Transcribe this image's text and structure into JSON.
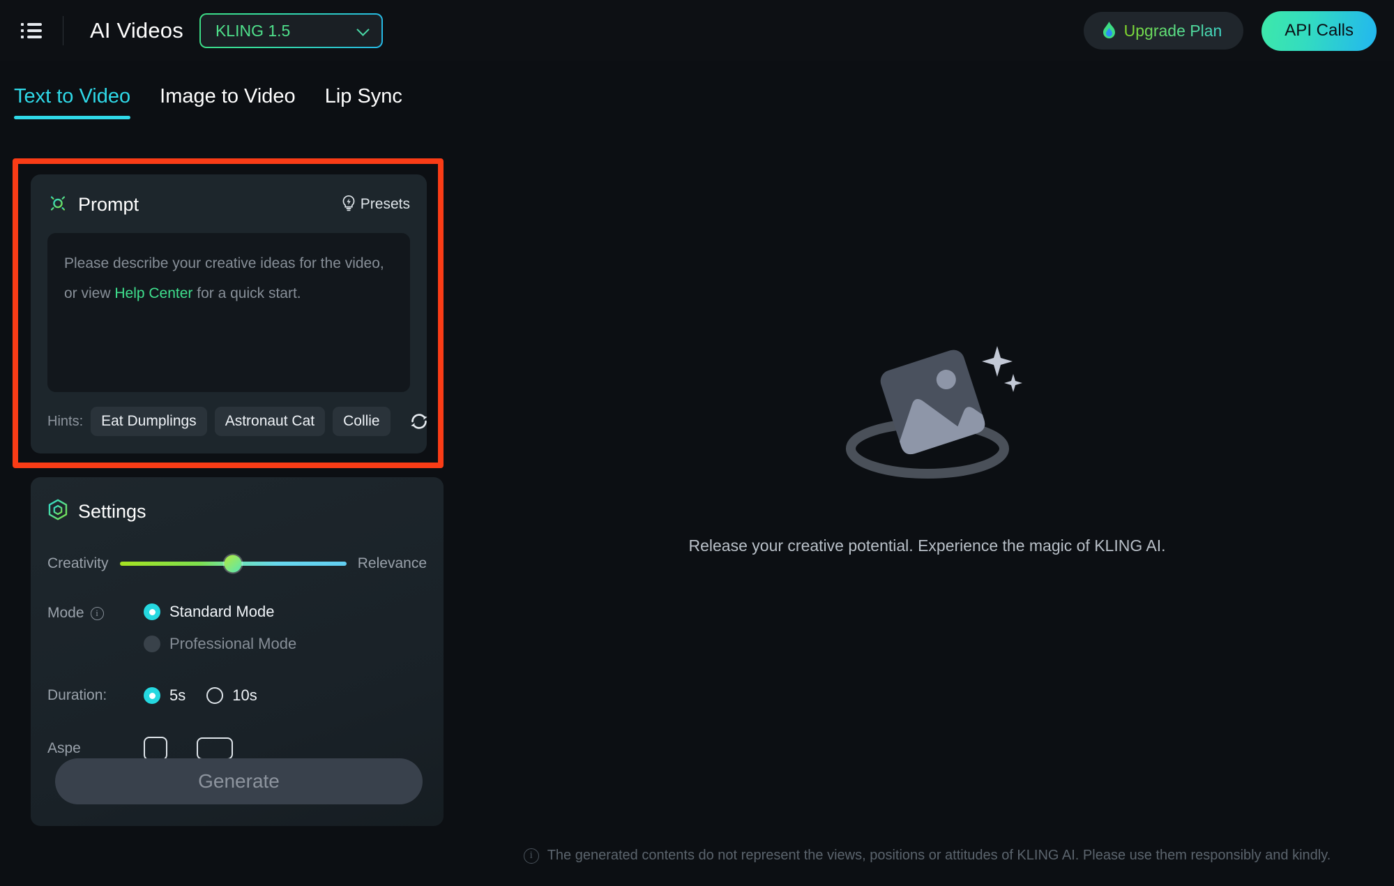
{
  "topbar": {
    "menu_icon": "list-menu-icon",
    "app_title": "AI Videos",
    "model_select": {
      "value": "KLING 1.5",
      "chevron_icon": "chevron-down-icon"
    },
    "upgrade": {
      "label": "Upgrade Plan",
      "icon": "flame-icon"
    },
    "api_calls": {
      "label": "API Calls"
    }
  },
  "tabs": [
    {
      "label": "Text to Video",
      "active": true
    },
    {
      "label": "Image to Video",
      "active": false
    },
    {
      "label": "Lip Sync",
      "active": false
    }
  ],
  "prompt_panel": {
    "icon": "brightness-sun-icon",
    "title": "Prompt",
    "presets": {
      "label": "Presets",
      "icon": "lightbulb-idea-icon"
    },
    "textarea": {
      "value": "",
      "placeholder_line1": "Please describe your creative ideas for the video,",
      "placeholder_line2_before": "or view ",
      "placeholder_link": "Help Center",
      "placeholder_line2_after": " for a quick start."
    },
    "hints_label": "Hints:",
    "hints": [
      "Eat Dumplings",
      "Astronaut Cat",
      "Collie"
    ],
    "refresh_icon": "refresh-icon",
    "highlight_color": "#fa3c16"
  },
  "settings_panel": {
    "icon": "hexagon-settings-icon",
    "title": "Settings",
    "creativity": {
      "left_label": "Creativity",
      "right_label": "Relevance",
      "value_percent": 50
    },
    "mode": {
      "label": "Mode",
      "info_icon": "info-icon",
      "options": [
        {
          "label": "Standard Mode",
          "selected": true
        },
        {
          "label": "Professional Mode",
          "selected": false
        }
      ]
    },
    "duration": {
      "label": "Duration:",
      "options": [
        {
          "label": "5s",
          "selected": true
        },
        {
          "label": "10s",
          "selected": false
        }
      ]
    },
    "aspect_ratio": {
      "label": "Aspe",
      "options": [
        {
          "icon": "aspect-1-1-icon",
          "selected": false
        },
        {
          "icon": "aspect-16-9-icon",
          "selected": false
        }
      ]
    }
  },
  "generate_button": {
    "label": "Generate",
    "enabled": false
  },
  "canvas": {
    "placeholder_icon": "image-placeholder-illustration",
    "caption": "Release your creative potential. Experience the magic of KLING AI."
  },
  "footer": {
    "icon": "info-icon",
    "text": "The generated contents do not represent the views, positions or attitudes of KLING AI. Please use them responsibly and kindly."
  },
  "colors": {
    "accent_cyan": "#2fd9e8",
    "accent_green": "#4fe08b",
    "highlight_red": "#fa3c16",
    "page_bg": "#0c0f13",
    "panel_bg": "#1d262c"
  }
}
